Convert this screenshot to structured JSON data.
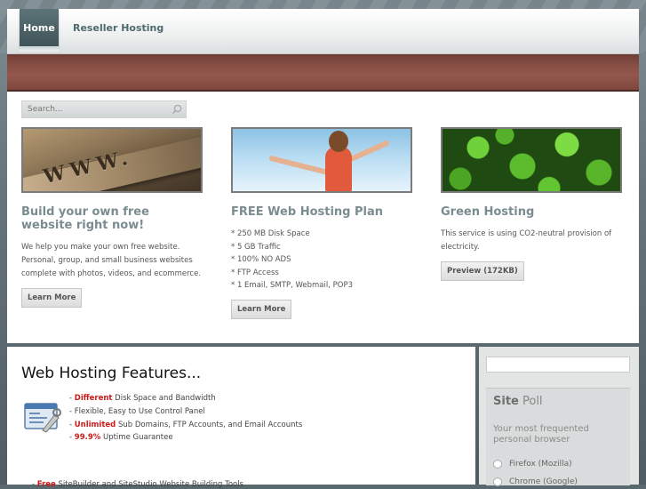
{
  "nav": {
    "home": "Home",
    "reseller": "Reseller Hosting"
  },
  "search": {
    "placeholder": "Search..."
  },
  "cards": [
    {
      "title": "Build your own free website right now!",
      "text": "We help you make your own free website. Personal, group, and small business websites complete with photos, videos, and ecommerce.",
      "button": "Learn More",
      "image_text": "WWW."
    },
    {
      "title": "FREE Web Hosting Plan",
      "items": [
        "* 250 MB Disk Space",
        "* 5 GB Traffic",
        "* 100% NO ADS",
        "* FTP Access",
        "* 1 Email, SMTP, Webmail, POP3"
      ],
      "button": "Learn More"
    },
    {
      "title": "Green Hosting",
      "text": "This service is using CO2-neutral provision of electricity.",
      "button": "Preview (172KB)"
    }
  ],
  "features": {
    "heading": "Web Hosting Features...",
    "items": [
      {
        "prefix": "- ",
        "highlight": "Different",
        "rest": " Disk Space and Bandwidth"
      },
      {
        "prefix": "- ",
        "highlight": "",
        "rest": "Flexible, Easy to Use Control Panel"
      },
      {
        "prefix": "- ",
        "highlight": "Unlimited",
        "rest": " Sub Domains, FTP Accounts, and Email Accounts"
      },
      {
        "prefix": "- ",
        "highlight": "99.9%",
        "rest": " Uptime Guarantee"
      }
    ],
    "more": {
      "prefix": "- ",
      "highlight": "Free",
      "rest": " SiteBuilder and SiteStudio Website Building Tools"
    }
  },
  "poll": {
    "title_strong": "Site",
    "title_light": " Poll",
    "question": "Your most frequented personal browser",
    "options": [
      "Firefox (Mozilla)",
      "Chrome (Google)"
    ]
  },
  "colors": {
    "accent_red": "#cc1a1a",
    "banner": "#8a5046",
    "nav_active": "#4f6468"
  }
}
